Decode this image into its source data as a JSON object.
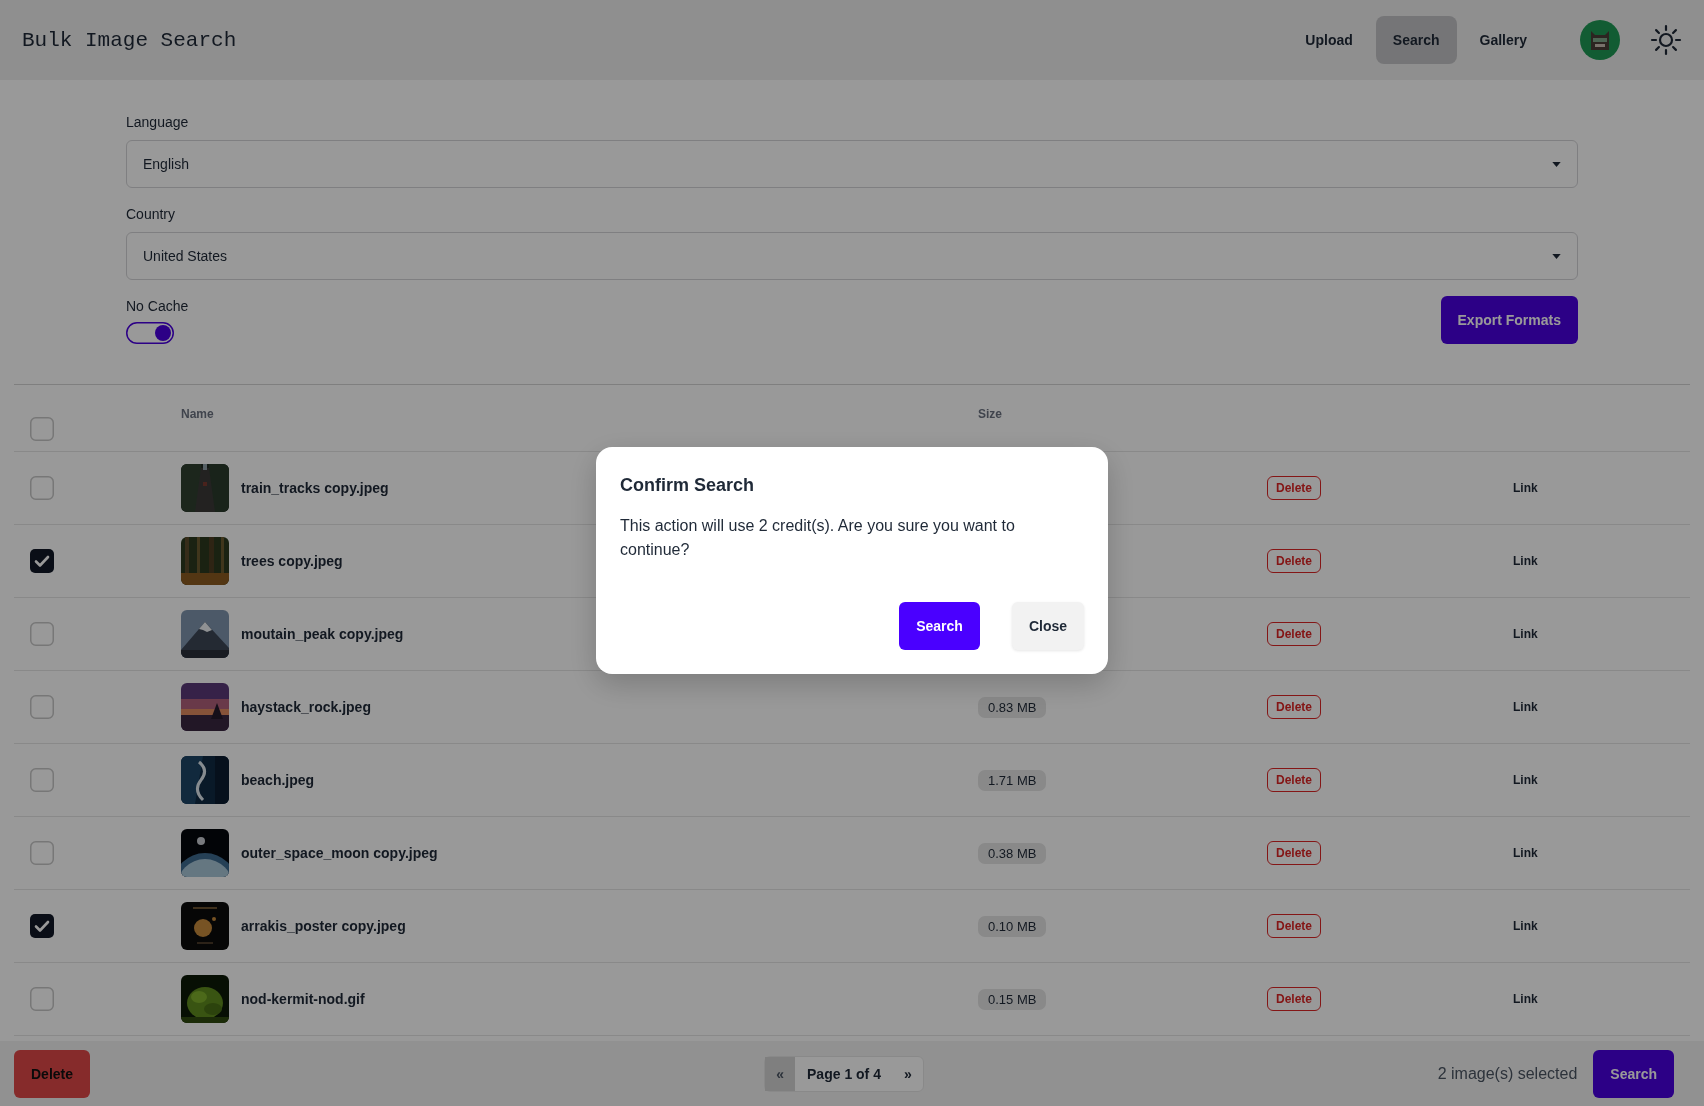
{
  "header": {
    "title": "Bulk Image Search",
    "nav": [
      {
        "label": "Upload",
        "selected": false
      },
      {
        "label": "Search",
        "selected": true
      },
      {
        "label": "Gallery",
        "selected": false
      }
    ]
  },
  "form": {
    "language": {
      "label": "Language",
      "value": "English"
    },
    "country": {
      "label": "Country",
      "value": "United States"
    },
    "no_cache": {
      "label": "No Cache",
      "on": true
    },
    "export_button": "Export Formats"
  },
  "table": {
    "select_all": {
      "checked": false
    },
    "columns": [
      "Name",
      "Size"
    ],
    "rows": [
      {
        "name": "train_tracks copy.jpeg",
        "checked": false,
        "action": "Delete",
        "link": "Link"
      },
      {
        "name": "trees copy.jpeg",
        "checked": true,
        "action": "Delete",
        "link": "Link"
      },
      {
        "name": "moutain_peak copy.jpeg",
        "checked": false,
        "action": "Delete",
        "link": "Link"
      },
      {
        "name": "haystack_rock.jpeg",
        "checked": false,
        "size": "0.83 MB",
        "action": "Delete",
        "link": "Link"
      },
      {
        "name": "beach.jpeg",
        "checked": false,
        "size": "1.71 MB",
        "action": "Delete",
        "link": "Link"
      },
      {
        "name": "outer_space_moon copy.jpeg",
        "checked": false,
        "size": "0.38 MB",
        "action": "Delete",
        "link": "Link"
      },
      {
        "name": "arrakis_poster copy.jpeg",
        "checked": true,
        "size": "0.10 MB",
        "action": "Delete",
        "link": "Link"
      },
      {
        "name": "nod-kermit-nod.gif",
        "checked": false,
        "size": "0.15 MB",
        "action": "Delete",
        "link": "Link"
      }
    ]
  },
  "bottom_bar": {
    "delete_button": "Delete",
    "pagination": {
      "prev": "«",
      "prev_disabled": true,
      "page": "Page 1 of 4",
      "next": "»"
    },
    "selection_count": "2 image(s) selected",
    "search_button": "Search"
  },
  "dialog": {
    "title": "Confirm Search",
    "message": "This action will use 2 credit(s). Are you sure you want to continue?",
    "confirm_button": "Search",
    "close_button": "Close"
  }
}
